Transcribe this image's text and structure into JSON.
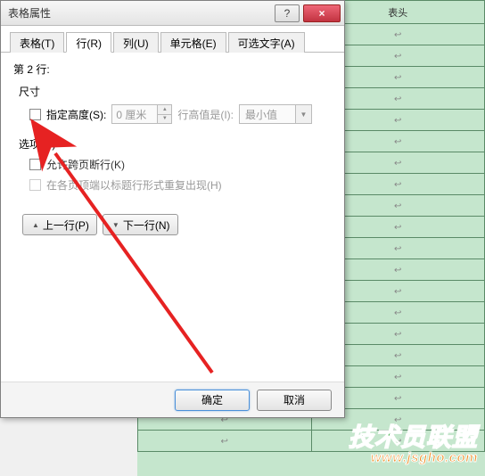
{
  "dialog": {
    "title": "表格属性",
    "tabs": {
      "table": "表格(T)",
      "row": "行(R)",
      "column": "列(U)",
      "cell": "单元格(E)",
      "alt": "可选文字(A)"
    },
    "row_indicator": "第 2 行:",
    "size_section": "尺寸",
    "specify_height": "指定高度(S):",
    "height_value": "0 厘米",
    "row_height_is": "行高值是(I):",
    "row_height_mode": "最小值",
    "option_section": "选项(O)",
    "allow_break": "允许跨页断行(K)",
    "repeat_header": "在各页顶端以标题行形式重复出现(H)",
    "prev_row": "上一行(P)",
    "next_row": "下一行(N)",
    "ok": "确定",
    "cancel": "取消",
    "help_glyph": "?",
    "close_glyph": "×"
  },
  "bg": {
    "header_col2": "表头",
    "cell_mark": "↩"
  },
  "watermark": {
    "text": "技术员联盟",
    "url": "www.jsgho.com"
  }
}
